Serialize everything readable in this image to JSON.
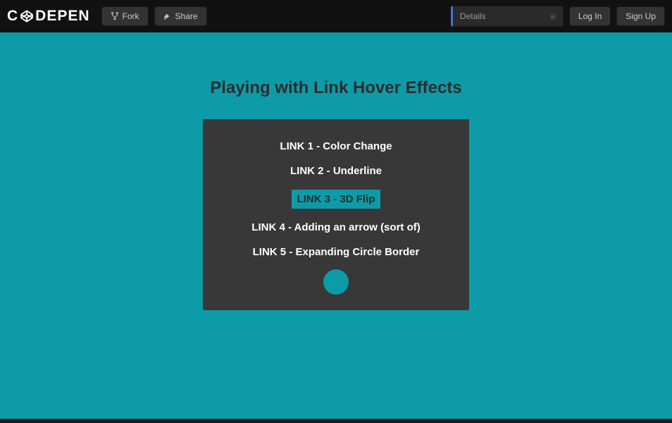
{
  "header": {
    "logo_left": "C",
    "logo_right": "DEPEN",
    "fork_label": "Fork",
    "share_label": "Share",
    "details_label": "Details",
    "login_label": "Log In",
    "signup_label": "Sign Up"
  },
  "main": {
    "title": "Playing with Link Hover Effects",
    "links": {
      "link1": "LINK 1 - Color Change",
      "link2": "LINK 2 - Underline",
      "link3": "LINK 3 - 3D Flip",
      "link4": "LINK 4 - Adding an arrow (sort of)",
      "link5": "LINK 5 - Expanding Circle Border"
    }
  }
}
